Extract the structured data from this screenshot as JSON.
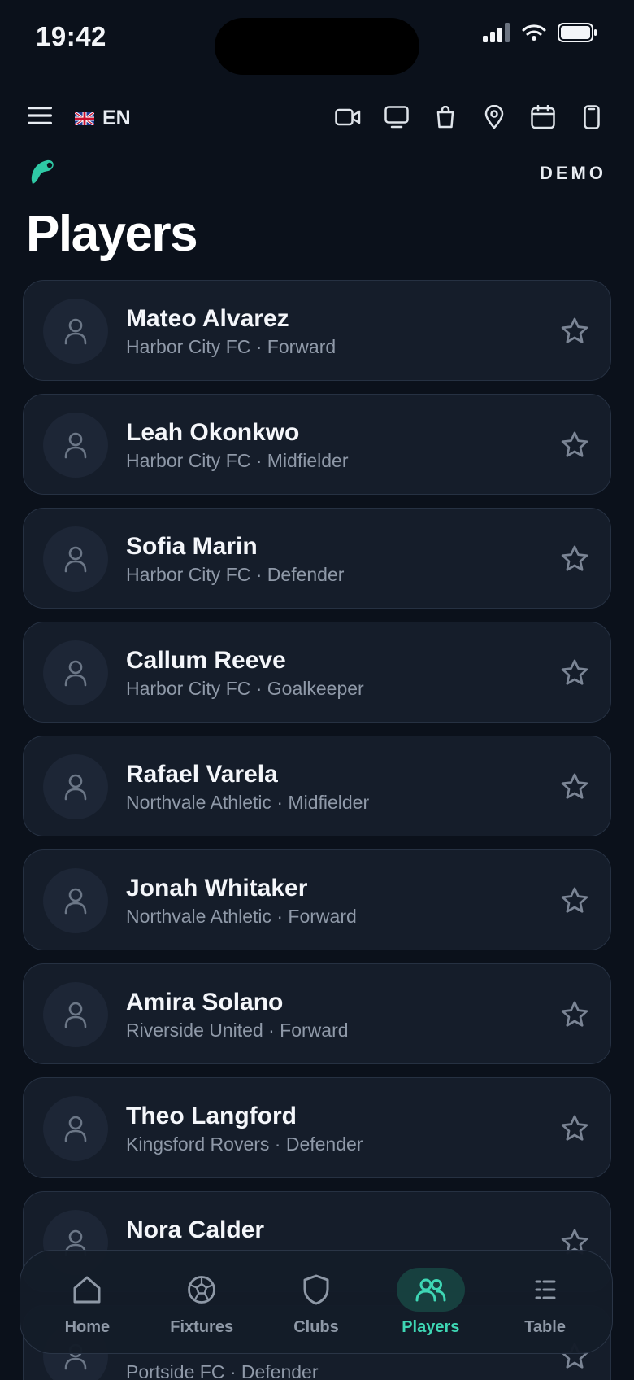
{
  "status_bar": {
    "time": "19:42"
  },
  "header": {
    "language": "EN",
    "badge": "DEMO"
  },
  "page": {
    "title": "Players"
  },
  "players": [
    {
      "name": "Mateo Alvarez",
      "meta": "Harbor City FC · Forward"
    },
    {
      "name": "Leah Okonkwo",
      "meta": "Harbor City FC · Midfielder"
    },
    {
      "name": "Sofia Marin",
      "meta": "Harbor City FC · Defender"
    },
    {
      "name": "Callum Reeve",
      "meta": "Harbor City FC · Goalkeeper"
    },
    {
      "name": "Rafael Varela",
      "meta": "Northvale Athletic · Midfielder"
    },
    {
      "name": "Jonah Whitaker",
      "meta": "Northvale Athletic · Forward"
    },
    {
      "name": "Amira Solano",
      "meta": "Riverside United · Forward"
    },
    {
      "name": "Theo Langford",
      "meta": "Kingsford Rovers · Defender"
    },
    {
      "name": "Nora Calder",
      "meta": ""
    },
    {
      "name": "",
      "meta": "Portside FC · Defender"
    }
  ],
  "tabs": [
    {
      "label": "Home",
      "icon": "home-icon"
    },
    {
      "label": "Fixtures",
      "icon": "football-icon"
    },
    {
      "label": "Clubs",
      "icon": "shield-icon"
    },
    {
      "label": "Players",
      "icon": "people-icon",
      "active": true
    },
    {
      "label": "Table",
      "icon": "table-icon"
    }
  ],
  "colors": {
    "accent": "#3ed6b4",
    "background": "#0b111b",
    "card": "#151d2a"
  }
}
